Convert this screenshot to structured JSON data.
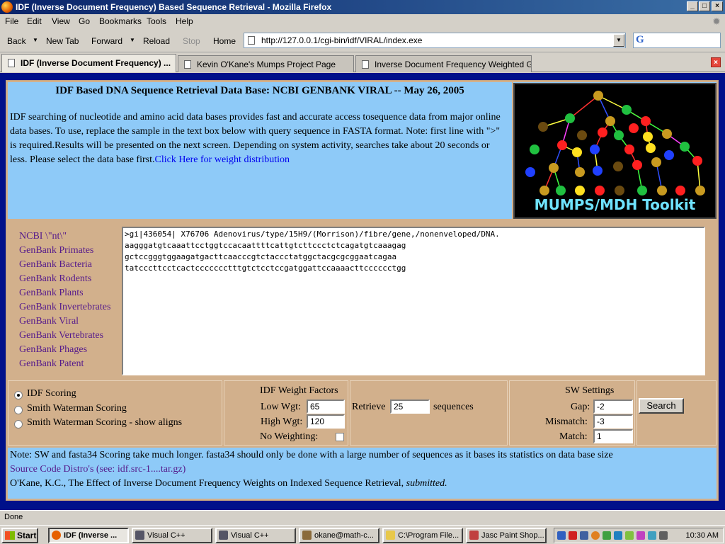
{
  "window": {
    "title": "IDF (Inverse Document Frequency) Based Sequence Retrieval - Mozilla Firefox"
  },
  "menu": [
    "File",
    "Edit",
    "View",
    "Go",
    "Bookmarks",
    "Tools",
    "Help"
  ],
  "nav": {
    "back": "Back",
    "new_tab": "New Tab",
    "forward": "Forward",
    "reload": "Reload",
    "stop": "Stop",
    "home": "Home",
    "url": "http://127.0.0.1/cgi-bin/idf/VIRAL/index.exe",
    "search_engine": "G"
  },
  "tabs": [
    "IDF (Inverse Document Frequency) ...",
    "Kevin O'Kane's Mumps Project Page",
    "Inverse Document Frequency Weighted Ge..."
  ],
  "header": {
    "title": "IDF Based DNA Sequence Retrieval Data Base: NCBI GENBANK VIRAL -- May 26, 2005",
    "description": "IDF searching of nucleotide and amino acid data bases provides fast and accurate access tosequence data from major online data bases. To use, replace the sample in the text box below with query sequence in FASTA format. Note: first line with \">\" is required.Results will be presented on the next screen. Depending on system activity, searches take about 20 seconds or less. Please select the data base first.",
    "link": "Click Here for weight distribution"
  },
  "logo": {
    "text": "MUMPS/MDH Toolkit"
  },
  "databases": [
    "NCBI \\\"nt\\\"",
    "GenBank Primates",
    "GenBank Bacteria",
    "GenBank Rodents",
    "GenBank Plants",
    "GenBank Invertebrates",
    "GenBank Viral",
    "GenBank Vertebrates",
    "GenBank Phages",
    "GenBank Patent"
  ],
  "sequence_text": ">gi|436054| X76706 Adenovirus/type/15H9/(Morrison)/fibre/gene,/nonenveloped/DNA.\naagggatgtcaaattcctggtccacaattttcattgtcttccctctcagatgtcaaagag\ngctccgggtggaagatgacttcaacccgtctaccctatggctacgcgcggaatcagaa\ntatcccttcctcactccccccctttgtctcctccgatggattccaaaacttcccccctgg",
  "scoring": {
    "options": [
      "IDF Scoring",
      "Smith Waterman Scoring",
      "Smith Waterman Scoring - show aligns"
    ],
    "selected_index": 0
  },
  "idf_weights": {
    "title": "IDF Weight Factors",
    "low_label": "Low Wgt:",
    "low_value": "65",
    "high_label": "High Wgt:",
    "high_value": "120",
    "no_weighting_label": "No Weighting:",
    "no_weighting_checked": false
  },
  "retrieve": {
    "label": "Retrieve",
    "value": "25",
    "suffix": "sequences"
  },
  "sw_settings": {
    "title": "SW Settings",
    "gap_label": "Gap:",
    "gap_value": "-2",
    "mismatch_label": "Mismatch:",
    "mismatch_value": "-3",
    "match_label": "Match:",
    "match_value": "1"
  },
  "search_button": "Search",
  "footer": {
    "note": "Note: SW and fasta34 Scoring take much longer. fasta34 should only be done with a large number of sequences as it bases its statistics on data base size",
    "source_link": "Source Code Distro's (see: idf.src-1....tar.gz)",
    "citation_pre": "O'Kane, K.C., The Effect of Inverse Document Frequency Weights on Indexed Sequence Retrieval,",
    "citation_em": "submitted."
  },
  "status": "Done",
  "taskbar": {
    "start": "Start",
    "items": [
      "IDF (Inverse ...",
      "Visual C++",
      "Visual C++",
      "okane@math-c...",
      "C:\\Program File...",
      "Jasc Paint Shop..."
    ],
    "clock": "10:30 AM"
  }
}
